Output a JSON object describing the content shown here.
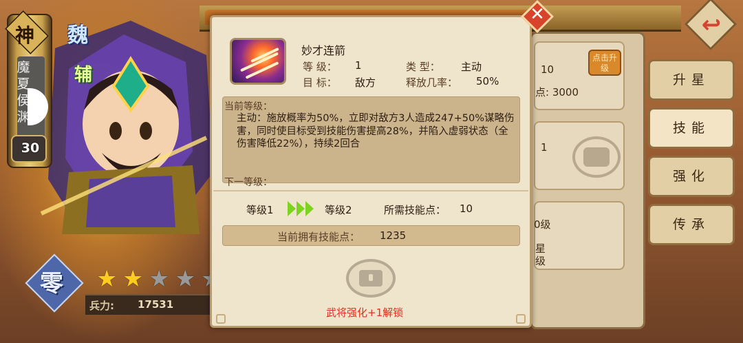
{
  "hero": {
    "rank_badge": "神",
    "faction": "魏",
    "role": "辅",
    "name_vertical": "魔夏侯渊",
    "level": "30",
    "element_badge": "零",
    "stars_total": 5,
    "stars_filled": 2,
    "power_label": "兵力:",
    "power_value": "17531"
  },
  "skill_dialog": {
    "skill_name": "妙才连箭",
    "level_label": "等 级：",
    "level_value": "1",
    "type_label": "类 型：",
    "type_value": "主动",
    "target_label": "目 标：",
    "target_value": "敌方",
    "rate_label": "释放几率：",
    "rate_value": "50%",
    "current_level_title": "当前等级：",
    "description": "主动：施放概率为50%，立即对敌方3人造成247+50%谋略伤害，同时使目标受到技能伤害提高28%，并陷入虚弱状态（全伤害降低22%），持续2回合",
    "next_level_title": "下一等级：",
    "from_level": "等级1",
    "to_level": "等级2",
    "required_points_label": "所需技能点：",
    "required_points_value": "10",
    "owned_points_label": "当前拥有技能点：",
    "owned_points_value": "1235",
    "unlock_hint": "武将强化+1解锁"
  },
  "right_panel": {
    "upgrade_chip": "点击升级",
    "value_a": "10",
    "value_b_suffix": "点: 3000",
    "value_c": "1",
    "value_d": "0级",
    "value_e": "星",
    "value_f": "级"
  },
  "tabs": [
    {
      "label": "升星"
    },
    {
      "label": "技能"
    },
    {
      "label": "强化"
    },
    {
      "label": "传承"
    }
  ],
  "icons": {
    "back": "back-arrow-icon",
    "close": "close-icon",
    "lock": "lock-icon",
    "star": "star-icon",
    "chevrons": "triple-chevron-icon"
  },
  "colors": {
    "accent_red": "#d7432b",
    "star_on": "#ffcc1f",
    "chevron_green": "#7ed321",
    "unlock_red": "#e0301e"
  }
}
